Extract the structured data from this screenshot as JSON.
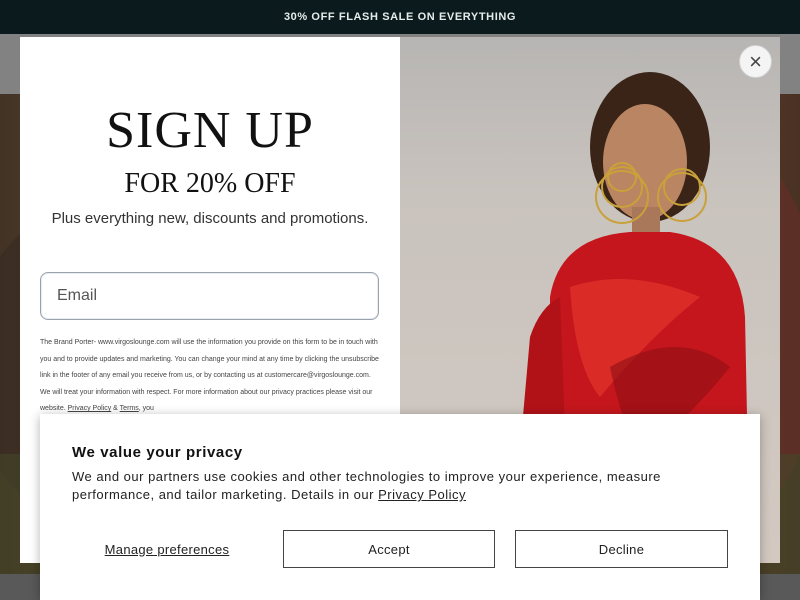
{
  "announcement": {
    "text": "30% OFF FLASH SALE ON EVERYTHING"
  },
  "signup_popup": {
    "headline": "SIGN UP",
    "subheadline": "FOR 20% OFF",
    "tagline": "Plus everything new, discounts and promotions.",
    "email_placeholder": "Email",
    "legal_text": "The Brand Porter- www.virgoslounge.com will use the information you provide on this form to be in touch with you and to provide updates and marketing. You can change your mind at any time by clicking the unsubscribe link in the footer of any email you receive from us, or by contacting us at customercare@virgoslounge.com. We will treat your information with respect. For more information about our privacy practices please visit our website.",
    "privacy_link": "Privacy Policy",
    "amp": "&",
    "terms_link": "Terms",
    "legal_tail": "you",
    "close_label": "×"
  },
  "cookie_banner": {
    "title": "We value your privacy",
    "body": "We and our partners use cookies and other technologies to improve your experience, measure performance, and tailor marketing. Details in our",
    "privacy_link": "Privacy Policy",
    "manage_label": "Manage preferences",
    "accept_label": "Accept",
    "decline_label": "Decline"
  },
  "colors": {
    "announcement_bg": "#0b1a1c",
    "dress_red": "#c4161c"
  }
}
